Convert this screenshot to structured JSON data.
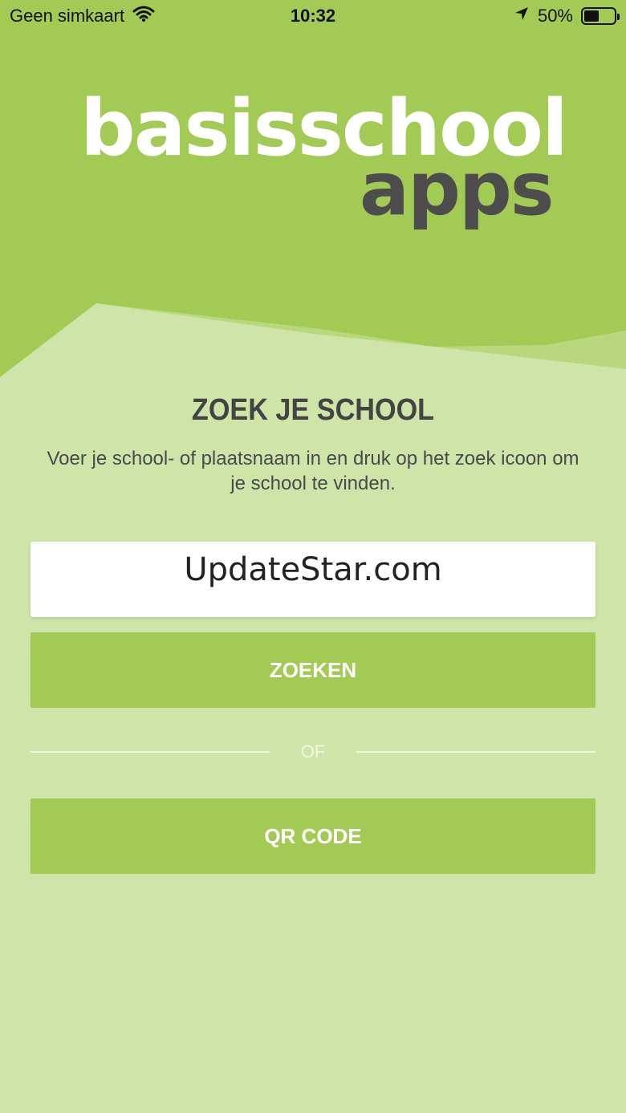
{
  "status_bar": {
    "carrier": "Geen simkaart",
    "time": "10:32",
    "battery": "50%",
    "battery_level": 0.5,
    "icons": [
      "wifi-icon",
      "location-arrow-icon",
      "battery-icon"
    ]
  },
  "logo": {
    "main": "basisschool",
    "sub": "apps"
  },
  "title": "ZOEK JE SCHOOL",
  "subtitle": "Voer je school- of plaatsnaam in en druk op het zoek icoon om je school te vinden.",
  "search": {
    "value": "UpdateStar.com",
    "placeholder": ""
  },
  "buttons": {
    "search": "ZOEKEN",
    "qr": "QR CODE"
  },
  "divider_text": "OF",
  "colors": {
    "brand_green": "#a3ca54",
    "background": "#cfe4a8",
    "logo_grey": "#4d4d4d"
  }
}
